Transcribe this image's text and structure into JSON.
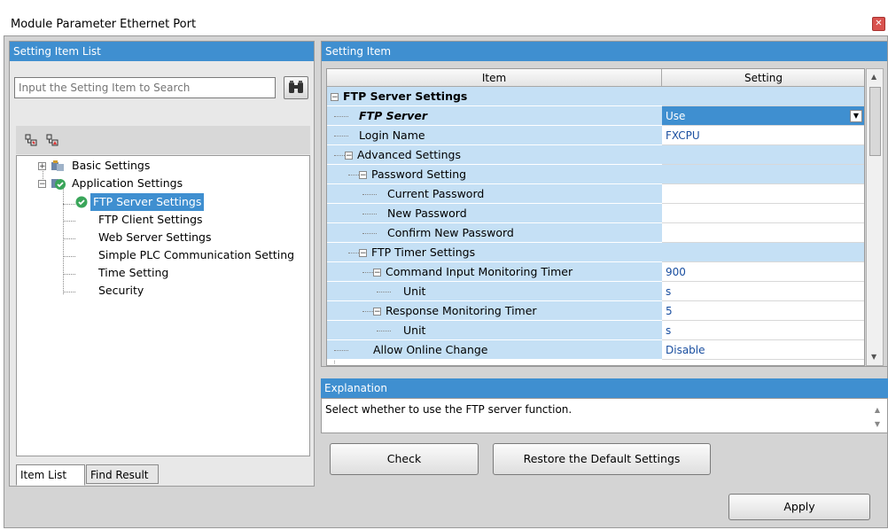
{
  "window": {
    "title": "Module Parameter Ethernet Port"
  },
  "left": {
    "header": "Setting Item List",
    "search_placeholder": "Input the Setting Item to Search",
    "tree": [
      {
        "label": "Basic Settings"
      },
      {
        "label": "Application Settings"
      },
      {
        "label": "FTP Server Settings"
      },
      {
        "label": "FTP Client Settings"
      },
      {
        "label": "Web Server Settings"
      },
      {
        "label": "Simple PLC Communication Setting"
      },
      {
        "label": "Time Setting"
      },
      {
        "label": "Security"
      }
    ],
    "tabs": [
      "Item List",
      "Find Result"
    ]
  },
  "right": {
    "header": "Setting Item",
    "columns": {
      "item": "Item",
      "setting": "Setting"
    },
    "rows": [
      {
        "item": "FTP Server Settings",
        "setting": ""
      },
      {
        "item": "FTP Server",
        "setting": "Use"
      },
      {
        "item": "Login Name",
        "setting": "FXCPU"
      },
      {
        "item": "Advanced Settings",
        "setting": ""
      },
      {
        "item": "Password Setting",
        "setting": ""
      },
      {
        "item": "Current Password",
        "setting": ""
      },
      {
        "item": "New Password",
        "setting": ""
      },
      {
        "item": "Confirm New Password",
        "setting": ""
      },
      {
        "item": "FTP Timer Settings",
        "setting": ""
      },
      {
        "item": "Command Input Monitoring Timer",
        "setting": "900"
      },
      {
        "item": "Unit",
        "setting": "s"
      },
      {
        "item": "Response Monitoring Timer",
        "setting": "5"
      },
      {
        "item": "Unit",
        "setting": "s"
      },
      {
        "item": "Allow Online Change",
        "setting": "Disable"
      }
    ]
  },
  "explanation": {
    "header": "Explanation",
    "text": "Select whether to use the FTP server function."
  },
  "buttons": {
    "check": "Check",
    "restore": "Restore the Default Settings",
    "apply": "Apply"
  }
}
